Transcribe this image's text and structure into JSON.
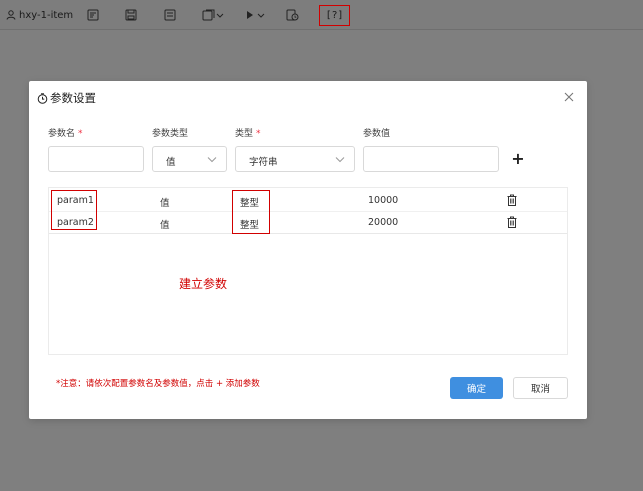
{
  "toolbar": {
    "title": "hxy-1-item",
    "highlight_label": "[?]",
    "icons": [
      "user-icon",
      "doc-edit-icon",
      "save-icon",
      "save-as-icon",
      "export-dropdown-icon",
      "run-dropdown-icon",
      "schedule-icon",
      "param-icon"
    ]
  },
  "dialog": {
    "title": "参数设置",
    "labels": {
      "name": "参数名",
      "param_type": "参数类型",
      "data_type": "类型",
      "value": "参数值",
      "required_mark": "*"
    },
    "inputs": {
      "name_value": "",
      "param_type_selected": "值",
      "data_type_selected": "字符串",
      "value_value": ""
    },
    "add_label": "+",
    "rows": [
      {
        "name": "param1",
        "param_type": "值",
        "data_type": "整型",
        "value": "10000"
      },
      {
        "name": "param2",
        "param_type": "值",
        "data_type": "整型",
        "value": "20000"
      }
    ],
    "annotation": "建立参数",
    "note": "*注意：请依次配置参数名及参数值，点击 + 添加参数",
    "ok_label": "确定",
    "cancel_label": "取消"
  },
  "colors": {
    "highlight": "#d10000",
    "primary": "#3f8fe0",
    "overlay": "#7f7f7f"
  }
}
